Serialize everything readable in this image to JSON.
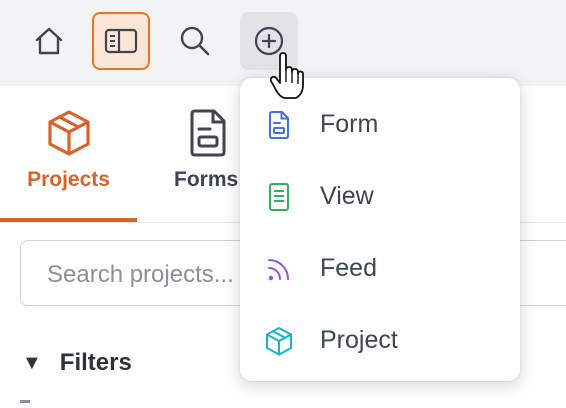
{
  "toolbar": {
    "buttons": [
      {
        "name": "home",
        "icon": "home-icon"
      },
      {
        "name": "sidebar",
        "icon": "sidebar-icon",
        "active": true
      },
      {
        "name": "search",
        "icon": "search-icon"
      },
      {
        "name": "add",
        "icon": "plus-circle-icon",
        "hovered": true
      }
    ]
  },
  "tabs": [
    {
      "label": "Projects",
      "icon": "box-icon",
      "active": true
    },
    {
      "label": "Forms",
      "icon": "form-icon",
      "active": false
    }
  ],
  "search": {
    "placeholder": "Search projects..."
  },
  "filters": {
    "caret": "▼",
    "label": "Filters"
  },
  "add_menu": {
    "items": [
      {
        "label": "Form",
        "icon": "form-icon",
        "color": "#3f73e0"
      },
      {
        "label": "View",
        "icon": "view-icon",
        "color": "#2fb35a"
      },
      {
        "label": "Feed",
        "icon": "rss-icon",
        "color": "#9b4fd8"
      },
      {
        "label": "Project",
        "icon": "box-icon",
        "color": "#17b3c9"
      }
    ]
  },
  "colors": {
    "accent": "#d9622b",
    "text": "#3d4552"
  }
}
